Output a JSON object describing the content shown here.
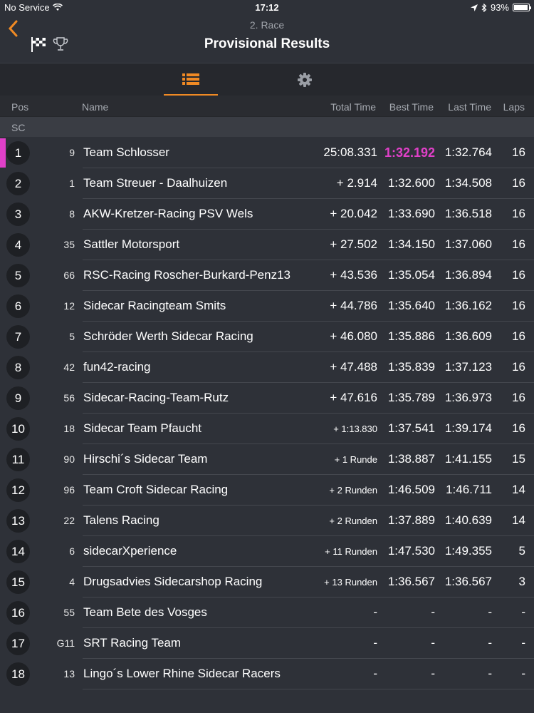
{
  "status": {
    "carrier": "No Service",
    "time": "17:12",
    "battery": "93%"
  },
  "header": {
    "subtitle": "2. Race",
    "title": "Provisional Results"
  },
  "colors": {
    "accent": "#f08a24",
    "fastest": "#e040c8",
    "background": "#2e3138"
  },
  "tabs": [
    {
      "icon": "list-icon",
      "active": true
    },
    {
      "icon": "gear-icon",
      "active": false
    }
  ],
  "columns": {
    "pos": "Pos",
    "name": "Name",
    "total": "Total Time",
    "best": "Best Time",
    "last": "Last Time",
    "laps": "Laps"
  },
  "section": "SC",
  "rows": [
    {
      "pos": "1",
      "num": "9",
      "name": "Team Schlosser",
      "total": "25:08.331",
      "best": "1:32.192",
      "last": "1:32.764",
      "laps": "16",
      "fastest": true
    },
    {
      "pos": "2",
      "num": "1",
      "name": "Team Streuer - Daalhuizen",
      "total": "+ 2.914",
      "best": "1:32.600",
      "last": "1:34.508",
      "laps": "16"
    },
    {
      "pos": "3",
      "num": "8",
      "name": "AKW-Kretzer-Racing  PSV Wels",
      "total": "+ 20.042",
      "best": "1:33.690",
      "last": "1:36.518",
      "laps": "16"
    },
    {
      "pos": "4",
      "num": "35",
      "name": "Sattler Motorsport",
      "total": "+ 27.502",
      "best": "1:34.150",
      "last": "1:37.060",
      "laps": "16"
    },
    {
      "pos": "5",
      "num": "66",
      "name": "RSC-Racing Roscher-Burkard-Penz13",
      "total": "+ 43.536",
      "best": "1:35.054",
      "last": "1:36.894",
      "laps": "16"
    },
    {
      "pos": "6",
      "num": "12",
      "name": "Sidecar Racingteam Smits",
      "total": "+ 44.786",
      "best": "1:35.640",
      "last": "1:36.162",
      "laps": "16"
    },
    {
      "pos": "7",
      "num": "5",
      "name": "Schröder Werth Sidecar Racing",
      "total": "+ 46.080",
      "best": "1:35.886",
      "last": "1:36.609",
      "laps": "16"
    },
    {
      "pos": "8",
      "num": "42",
      "name": "fun42-racing",
      "total": "+ 47.488",
      "best": "1:35.839",
      "last": "1:37.123",
      "laps": "16"
    },
    {
      "pos": "9",
      "num": "56",
      "name": "Sidecar-Racing-Team-Rutz",
      "total": "+ 47.616",
      "best": "1:35.789",
      "last": "1:36.973",
      "laps": "16"
    },
    {
      "pos": "10",
      "num": "18",
      "name": "Sidecar Team Pfaucht",
      "total": "+ 1:13.830",
      "best": "1:37.541",
      "last": "1:39.174",
      "laps": "16",
      "small": true
    },
    {
      "pos": "11",
      "num": "90",
      "name": "Hirschi´s Sidecar Team",
      "total": "+ 1 Runde",
      "best": "1:38.887",
      "last": "1:41.155",
      "laps": "15",
      "small": true
    },
    {
      "pos": "12",
      "num": "96",
      "name": "Team Croft Sidecar Racing",
      "total": "+ 2 Runden",
      "best": "1:46.509",
      "last": "1:46.711",
      "laps": "14",
      "small": true
    },
    {
      "pos": "13",
      "num": "22",
      "name": "Talens Racing",
      "total": "+ 2 Runden",
      "best": "1:37.889",
      "last": "1:40.639",
      "laps": "14",
      "small": true
    },
    {
      "pos": "14",
      "num": "6",
      "name": "sidecarXperience",
      "total": "+ 11 Runden",
      "best": "1:47.530",
      "last": "1:49.355",
      "laps": "5",
      "small": true
    },
    {
      "pos": "15",
      "num": "4",
      "name": "Drugsadvies Sidecarshop Racing",
      "total": "+ 13 Runden",
      "best": "1:36.567",
      "last": "1:36.567",
      "laps": "3",
      "small": true
    },
    {
      "pos": "16",
      "num": "55",
      "name": "Team Bete des Vosges",
      "total": "-",
      "best": "-",
      "last": "-",
      "laps": "-"
    },
    {
      "pos": "17",
      "num": "G11",
      "name": "SRT Racing Team",
      "total": "-",
      "best": "-",
      "last": "-",
      "laps": "-"
    },
    {
      "pos": "18",
      "num": "13",
      "name": "Lingo´s Lower Rhine Sidecar Racers",
      "total": "-",
      "best": "-",
      "last": "-",
      "laps": "-"
    }
  ]
}
